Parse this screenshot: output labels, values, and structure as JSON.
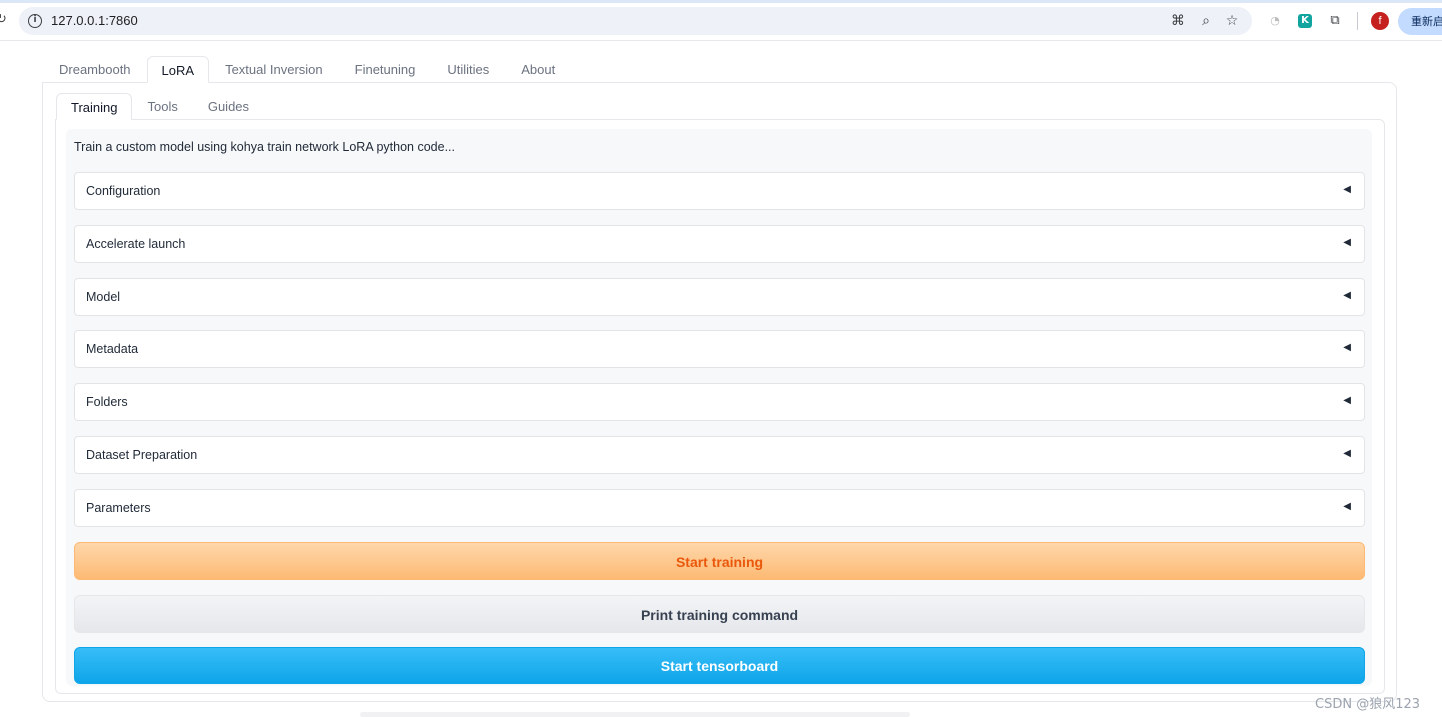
{
  "browser": {
    "url": "127.0.0.1:7860",
    "relaunch_label": "重新启",
    "profile_initial": "f"
  },
  "main_tabs": [
    {
      "label": "Dreambooth",
      "selected": false
    },
    {
      "label": "LoRA",
      "selected": true
    },
    {
      "label": "Textual Inversion",
      "selected": false
    },
    {
      "label": "Finetuning",
      "selected": false
    },
    {
      "label": "Utilities",
      "selected": false
    },
    {
      "label": "About",
      "selected": false
    }
  ],
  "sub_tabs": [
    {
      "label": "Training",
      "selected": true
    },
    {
      "label": "Tools",
      "selected": false
    },
    {
      "label": "Guides",
      "selected": false
    }
  ],
  "training": {
    "description": "Train a custom model using kohya train network LoRA python code...",
    "accordions": [
      {
        "label": "Configuration",
        "arrow": "◀"
      },
      {
        "label": "Accelerate launch",
        "arrow": "◀"
      },
      {
        "label": "Model",
        "arrow": "◀"
      },
      {
        "label": "Metadata",
        "arrow": "◀"
      },
      {
        "label": "Folders",
        "arrow": "◀"
      },
      {
        "label": "Dataset Preparation",
        "arrow": "◀"
      },
      {
        "label": "Parameters",
        "arrow": "◀"
      }
    ],
    "buttons": {
      "start_training": "Start training",
      "print_command": "Print training command",
      "start_tensorboard": "Start tensorboard"
    }
  },
  "watermark": "CSDN @狼风123",
  "colors": {
    "primary_button": "#fdba74",
    "primary_text": "#ea580c",
    "tensorboard_button": "#0ea5e9"
  }
}
